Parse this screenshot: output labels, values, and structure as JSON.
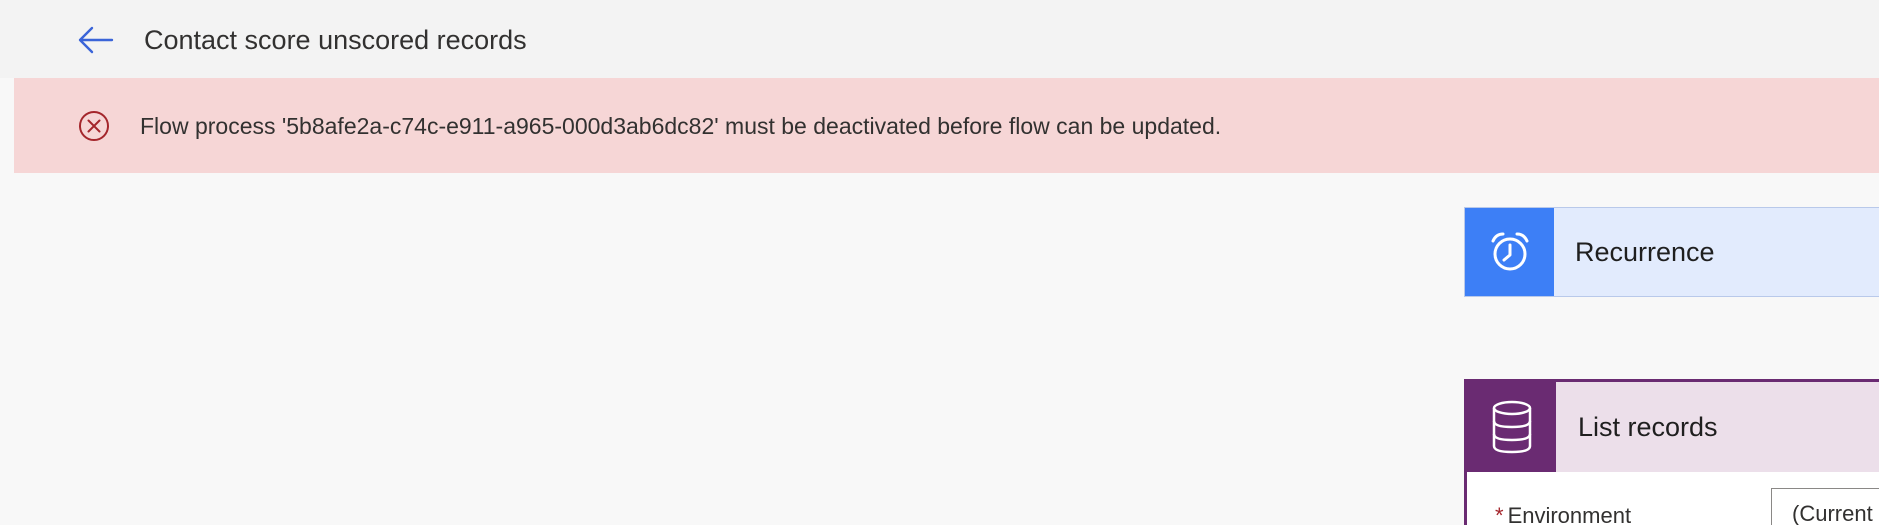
{
  "header": {
    "back_icon": "arrow-left-icon",
    "title": "Contact score unscored records"
  },
  "error_banner": {
    "icon": "error-circle-icon",
    "message": "Flow process '5b8afe2a-c74c-e911-a965-000d3ab6dc82' must be deactivated before flow can be updated."
  },
  "cards": {
    "recurrence": {
      "icon": "alarm-clock-icon",
      "title": "Recurrence"
    },
    "list_records": {
      "icon": "database-icon",
      "title": "List records",
      "fields": {
        "environment": {
          "required_mark": "*",
          "label": "Environment",
          "value": "(Current"
        }
      }
    }
  },
  "colors": {
    "accent_blue": "#3d7ff6",
    "error_bg": "#f6d6d6",
    "error_red": "#a4262c",
    "dataverse_purple": "#6a2b72",
    "back_arrow": "#3a64d8"
  }
}
